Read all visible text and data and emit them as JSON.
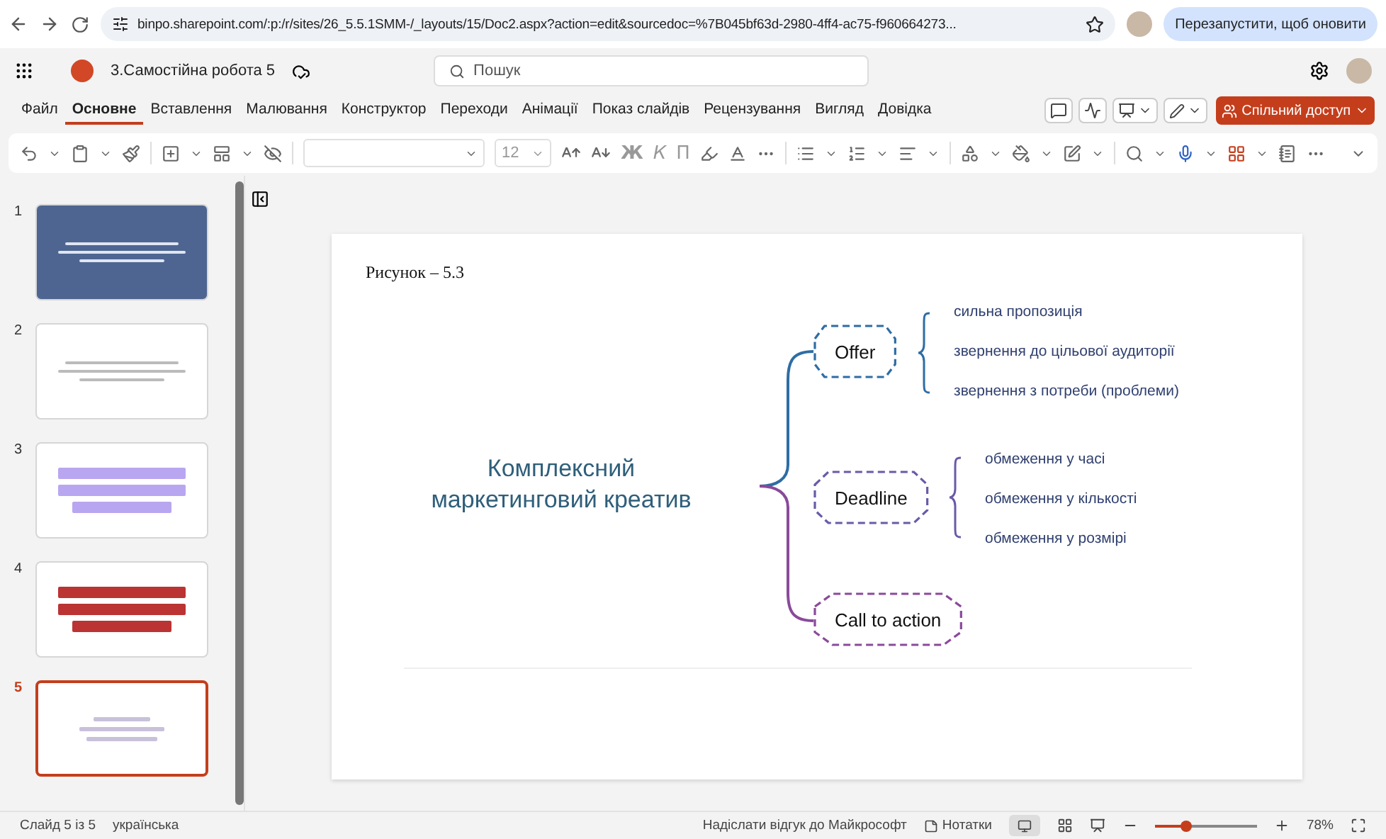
{
  "browser": {
    "url": "binpo.sharepoint.com/:p:/r/sites/26_5.5.1SMM-/_layouts/15/Doc2.aspx?action=edit&sourcedoc=%7B045bf63d-2980-4ff4-ac75-f960664273...",
    "restart_button": "Перезапустити, щоб оновити"
  },
  "app": {
    "document_title": "3.Самостійна робота 5",
    "search": {
      "placeholder": "Пошук"
    }
  },
  "ribbon_tabs": [
    {
      "label": "Файл",
      "selected": false
    },
    {
      "label": "Основне",
      "selected": true
    },
    {
      "label": "Вставлення",
      "selected": false
    },
    {
      "label": "Малювання",
      "selected": false
    },
    {
      "label": "Конструктор",
      "selected": false
    },
    {
      "label": "Переходи",
      "selected": false
    },
    {
      "label": "Анімації",
      "selected": false
    },
    {
      "label": "Показ слайдів",
      "selected": false
    },
    {
      "label": "Рецензування",
      "selected": false
    },
    {
      "label": "Вигляд",
      "selected": false
    },
    {
      "label": "Довідка",
      "selected": false
    }
  ],
  "share_button": "Спільний доступ",
  "toolbar": {
    "font_size": "12",
    "format_buttons": [
      "Ж",
      "К",
      "П"
    ]
  },
  "slides": [
    {
      "number": "1",
      "kind": "title",
      "selected": false
    },
    {
      "number": "2",
      "kind": "text",
      "selected": false
    },
    {
      "number": "3",
      "kind": "screenshot",
      "selected": false
    },
    {
      "number": "4",
      "kind": "screenshot",
      "selected": false
    },
    {
      "number": "5",
      "kind": "diagram",
      "selected": true
    }
  ],
  "slide": {
    "caption": "Рисунок – 5.3",
    "diagram": {
      "title": "Комплексний маркетинговий креатив",
      "branches": [
        {
          "label": "Offer",
          "color": "#2e6da4",
          "items": [
            "сильна пропозиція",
            "звернення до цільової аудиторії",
            "звернення з потреби (проблеми)"
          ]
        },
        {
          "label": "Deadline",
          "color": "#6a5aa8",
          "items": [
            "обмеження у часі",
            "обмеження у кількості",
            "обмеження у розмірі"
          ]
        },
        {
          "label": "Call to action",
          "color": "#8a4a9a"
        }
      ]
    }
  },
  "status_bar": {
    "slide_counter": "Слайд 5 із 5",
    "language": "українська",
    "feedback": "Надіслати відгук до Майкрософт",
    "notes": "Нотатки",
    "zoom": {
      "level": 0.3,
      "reading": "78%"
    }
  }
}
